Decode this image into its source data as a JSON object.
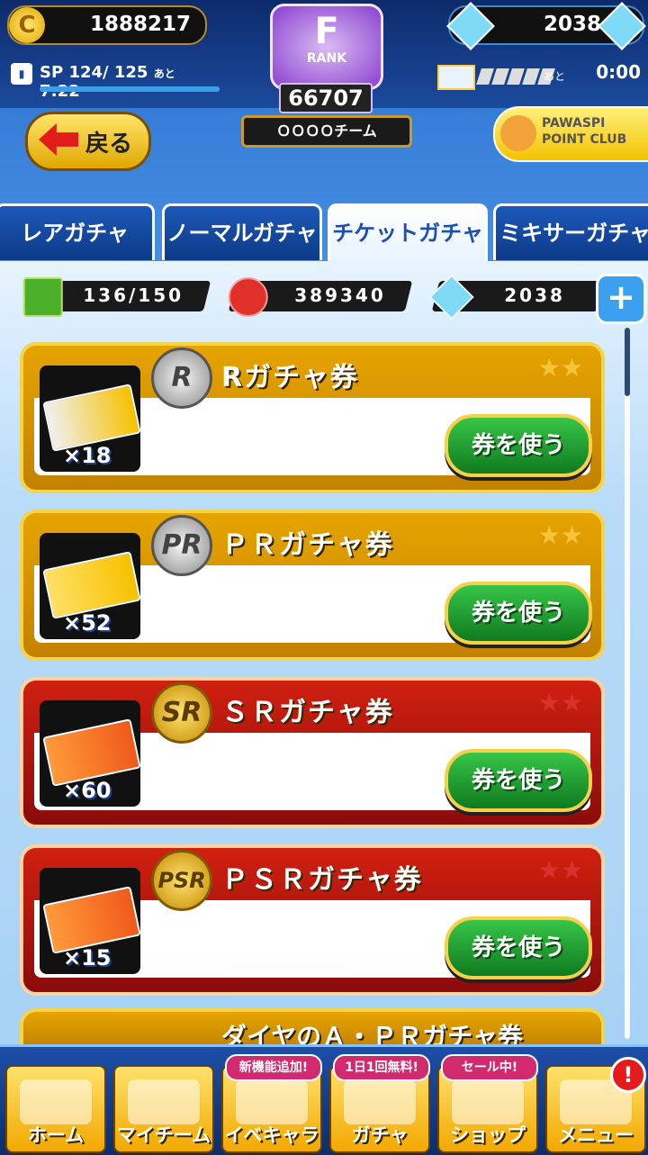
{
  "header": {
    "coins": "1888217",
    "gems": "2038",
    "sp_label": "SP",
    "sp_value": "124/ 125",
    "sp_ato": "あと",
    "sp_time": "7:22",
    "rank_label": "RANK",
    "rank_letter": "F",
    "rank_number": "66707",
    "team_name": "ＯＯＯＯチーム",
    "ticket_ato": "あと",
    "ticket_time": "0:00"
  },
  "nav": {
    "back_label": "戻る",
    "club_label_1": "PAWASPI",
    "club_label_2": "POINT CLUB"
  },
  "tabs": [
    {
      "label": "レアガチャ"
    },
    {
      "label": "ノーマルガチャ"
    },
    {
      "label": "チケットガチャ"
    },
    {
      "label": "ミキサーガチャ"
    }
  ],
  "resources": {
    "box": "136/150",
    "medal": "389340",
    "gem": "2038",
    "plus": "+"
  },
  "cards": [
    {
      "title": "Rガチャ券",
      "badge": "R",
      "count": "×18",
      "button": "券を使う",
      "style": "gold"
    },
    {
      "title": "ＰＲガチャ券",
      "badge": "PR",
      "count": "×52",
      "button": "券を使う",
      "style": "gold"
    },
    {
      "title": "ＳＲガチャ券",
      "badge": "SR",
      "count": "×60",
      "button": "券を使う",
      "style": "red"
    },
    {
      "title": "ＰＳＲガチャ券",
      "badge": "PSR",
      "count": "×15",
      "button": "券を使う",
      "style": "red"
    }
  ],
  "partial_card": {
    "title": "ダイヤのＡ・ＰＲガチャ券"
  },
  "bottom_nav": [
    {
      "label": "ホーム",
      "tag": ""
    },
    {
      "label": "マイチーム",
      "tag": ""
    },
    {
      "label": "イベキャラ",
      "tag": "新機能追加!"
    },
    {
      "label": "ガチャ",
      "tag": "1日1回無料!"
    },
    {
      "label": "ショップ",
      "tag": "セール中!"
    },
    {
      "label": "メニュー",
      "tag": ""
    }
  ],
  "notification_badge": "!"
}
